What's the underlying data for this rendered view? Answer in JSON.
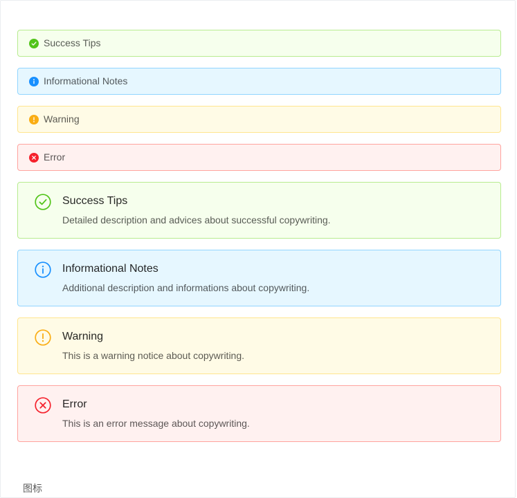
{
  "alerts_compact": [
    {
      "type": "success",
      "icon": "check-circle-filled-icon",
      "message": "Success Tips"
    },
    {
      "type": "info",
      "icon": "info-circle-filled-icon",
      "message": "Informational Notes"
    },
    {
      "type": "warning",
      "icon": "exclamation-circle-filled-icon",
      "message": "Warning"
    },
    {
      "type": "error",
      "icon": "close-circle-filled-icon",
      "message": "Error"
    }
  ],
  "alerts_detailed": [
    {
      "type": "success",
      "icon": "check-circle-outline-icon",
      "message": "Success Tips",
      "description": "Detailed description and advices about successful copywriting."
    },
    {
      "type": "info",
      "icon": "info-circle-outline-icon",
      "message": "Informational Notes",
      "description": "Additional description and informations about copywriting."
    },
    {
      "type": "warning",
      "icon": "exclamation-circle-outline-icon",
      "message": "Warning",
      "description": "This is a warning notice about copywriting."
    },
    {
      "type": "error",
      "icon": "close-circle-outline-icon",
      "message": "Error",
      "description": "This is an error message about copywriting."
    }
  ],
  "colors": {
    "success": "#52c41a",
    "info": "#1890ff",
    "warning": "#faad14",
    "error": "#f5222d"
  },
  "footer": {
    "label": "图标"
  }
}
